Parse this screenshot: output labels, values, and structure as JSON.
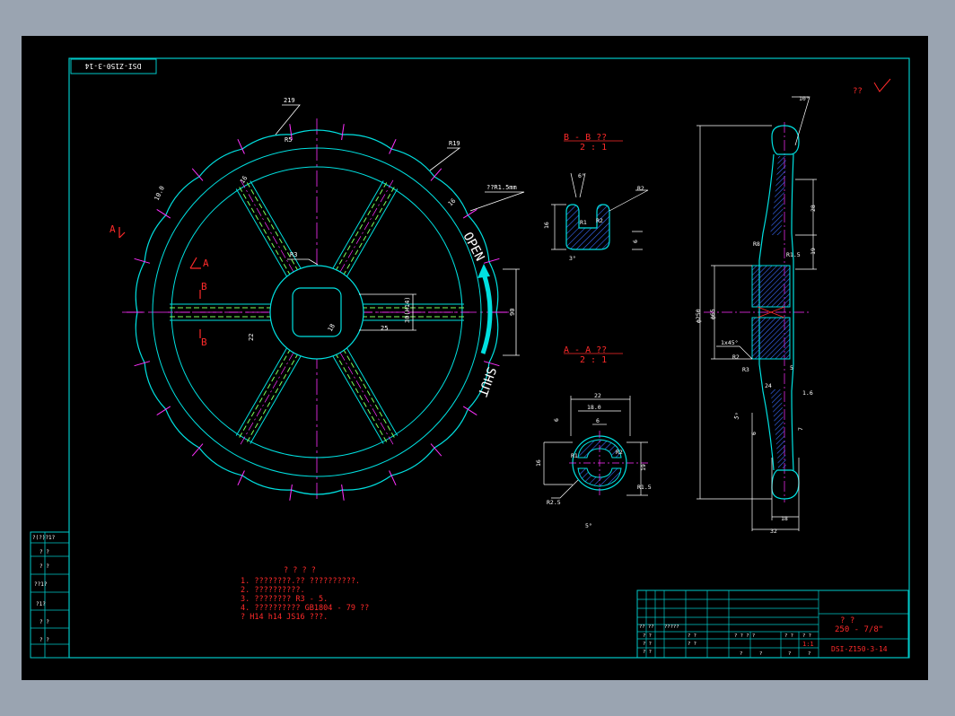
{
  "drawing": {
    "code_rotated": "DSI-Z150-3-14",
    "roughness_note": "??",
    "roughness_value": "√",
    "notes_header": "? ? ? ?",
    "notes": [
      "1.  ????????.?? ??????????.",
      "2.  ??????????.",
      "3.  ???????? R3 - 5.",
      "4.  ?????????? GB1804 - 79 ??",
      "    ? H14 h14 JS16 ???."
    ]
  },
  "wheel": {
    "label_open": "OPEN",
    "label_shut": "SHUT",
    "dims": {
      "d_219": "219",
      "r5": "R5",
      "r19": "R19",
      "note_r15": "??R1.5mm",
      "d_16": "16",
      "d_16b": "16",
      "d_100": "10.0",
      "d_90": "90",
      "r3": "R3",
      "d_25": "25",
      "d_22": "22",
      "d_30": "30(H14)",
      "d_18": "18",
      "d_r3b": "R3"
    },
    "section_labels": {
      "a_top": "A",
      "a_mid": "A",
      "b_top": "B",
      "b_bottom": "B"
    }
  },
  "section_bb": {
    "title": "B - B ??",
    "scale": "2 : 1",
    "dims": {
      "d_6": "6°",
      "r2": "R2",
      "d_16": "16",
      "r1": "R1",
      "r2b": "R2",
      "d_6b": "6",
      "d_3": "3°"
    }
  },
  "section_aa": {
    "title": "A - A ??",
    "scale": "2 : 1",
    "dims": {
      "d_22": "22",
      "d_180": "18.0",
      "d_6": "6",
      "d_6b": "6",
      "d_16": "16",
      "d_19": "19",
      "r25": "R2.5",
      "r15": "R1.5",
      "d_5": "5°",
      "r1": "R1",
      "r2": "R2"
    }
  },
  "side_view": {
    "dims": {
      "d_10": "10°",
      "d_28": "28",
      "d_19": "19",
      "r8": "R8",
      "r15": "R1.5",
      "d_250": "ф250",
      "d_65": "ф65",
      "chamfer": "1x45°",
      "r2": "R2",
      "r3": "R3",
      "d_5": "5",
      "d_24": "24",
      "d_16": "1.6",
      "d_5b": "5°",
      "d_6": "6",
      "d_7": "7",
      "d_18": "18",
      "d_32": "32"
    }
  },
  "title_block": {
    "name_chars": "?  ?",
    "product": "250 - 7/8\"",
    "scale": "1:1",
    "code": "DSI-Z150-3-14",
    "cells": [
      "?? ??",
      "?????",
      "? ? ? ?",
      "? ?",
      "? ?",
      "? ?",
      "? ?",
      "? ?",
      "? ?",
      "? ?",
      "?",
      "?",
      "?",
      "?"
    ]
  },
  "left_strip": {
    "labels": [
      "?(?)?1?",
      "?   ?",
      "?   ?",
      "??1?",
      "?1?",
      "?   ?",
      "?   ?"
    ]
  }
}
